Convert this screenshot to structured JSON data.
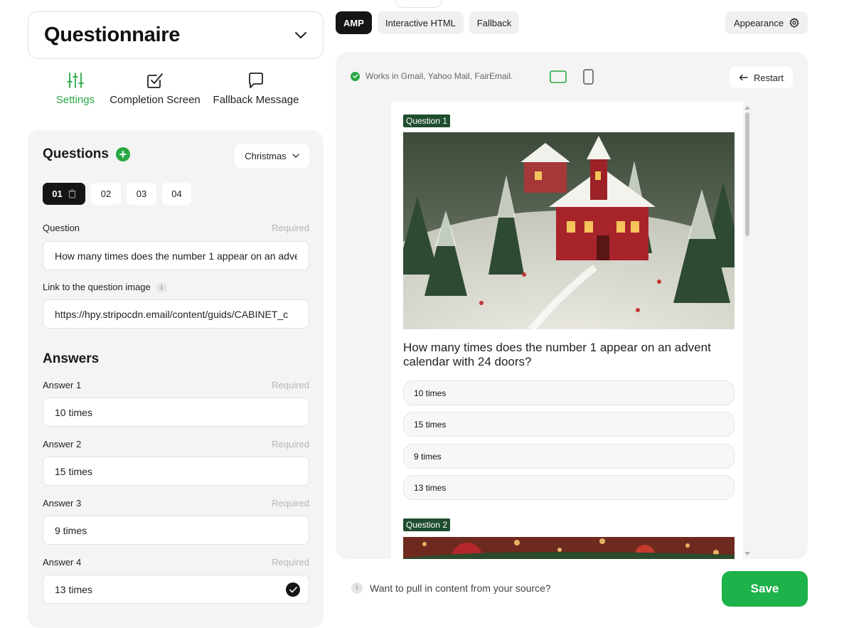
{
  "sidebar": {
    "form_type": "Questionnaire",
    "tabs": [
      {
        "label": "Settings",
        "icon": "sliders-icon"
      },
      {
        "label": "Completion Screen",
        "icon": "checkbox-icon"
      },
      {
        "label": "Fallback Message",
        "icon": "message-icon"
      }
    ],
    "questions": {
      "title": "Questions",
      "theme": "Christmas",
      "pills": [
        "01",
        "02",
        "03",
        "04"
      ],
      "question_label": "Question",
      "required": "Required",
      "question_value": "How many times does the number 1 appear on an advent calendar with 24 doors?",
      "image_label": "Link to the question image",
      "image_value": "https://hpy.stripocdn.email/content/guids/CABINET_c",
      "info_glyph": "i"
    },
    "answers": {
      "title": "Answers",
      "items": [
        {
          "label": "Answer 1",
          "value": "10 times"
        },
        {
          "label": "Answer 2",
          "value": "15 times"
        },
        {
          "label": "Answer 3",
          "value": "9 times"
        },
        {
          "label": "Answer 4",
          "value": "13 times"
        }
      ]
    }
  },
  "toolbar": {
    "tabs": [
      "AMP",
      "Interactive HTML",
      "Fallback"
    ],
    "appearance_label": "Appearance"
  },
  "preview": {
    "compat_text": "Works in Gmail, Yahoo Mail, FairEmail.",
    "restart_label": "Restart",
    "question1_badge": "Question 1",
    "question1_text": "How many times does the number 1 appear on an advent calendar with 24 doors?",
    "options": [
      "10 times",
      "15 times",
      "9 times",
      "13 times"
    ],
    "question2_badge": "Question 2"
  },
  "footer": {
    "pull_text": "Want to pull in content from your source?",
    "save_label": "Save"
  },
  "colors": {
    "accent_green": "#29a844",
    "save_green": "#1db24a",
    "badge_green": "#1f4d2f",
    "dark": "#151515"
  }
}
